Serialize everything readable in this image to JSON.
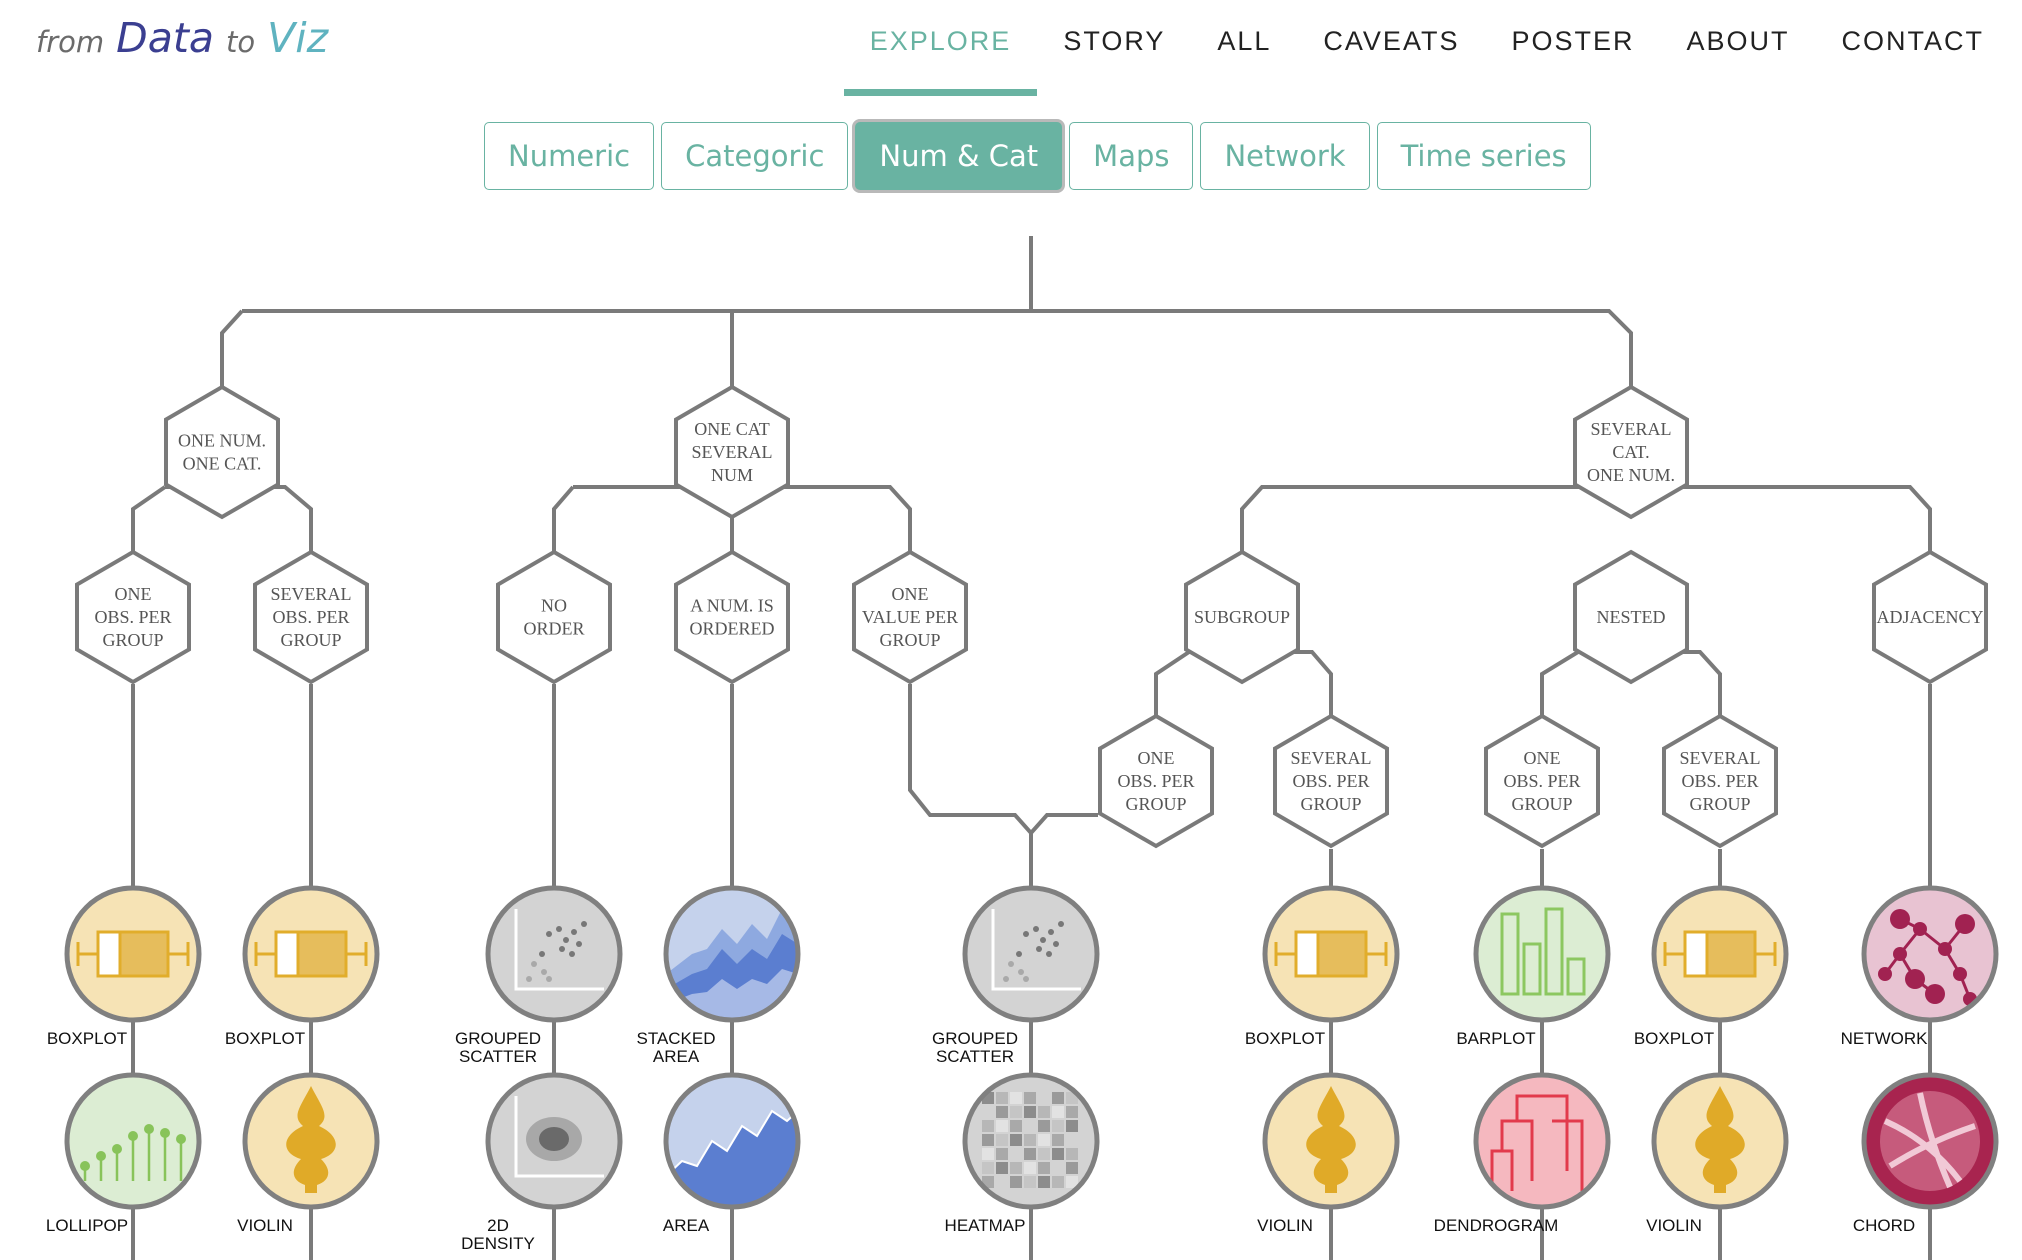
{
  "logo": {
    "from": "from",
    "data": "Data",
    "to": "to",
    "viz": "Viz"
  },
  "nav": [
    "EXPLORE",
    "STORY",
    "ALL",
    "CAVEATS",
    "POSTER",
    "ABOUT",
    "CONTACT"
  ],
  "tabs": [
    "Numeric",
    "Categoric",
    "Num & Cat",
    "Maps",
    "Network",
    "Time series"
  ],
  "active_tab": "Num & Cat",
  "colors": {
    "accent": "#69b3a2",
    "line": "#7a7a7a",
    "yellow": "#f6e3b5",
    "grey": "#d3d3d3",
    "blue": "#c5d2ec",
    "green": "#dcedd3",
    "pink": "#e8c3d2"
  },
  "hexagons": {
    "h1": [
      "ONE NUM.",
      "ONE CAT."
    ],
    "h2": [
      "ONE CAT",
      "SEVERAL",
      "NUM"
    ],
    "h3": [
      "SEVERAL",
      "CAT.",
      "ONE NUM."
    ],
    "h4": [
      "ONE",
      "OBS. PER",
      "GROUP"
    ],
    "h5": [
      "SEVERAL",
      "OBS. PER",
      "GROUP"
    ],
    "h6": [
      "NO",
      "ORDER"
    ],
    "h7": [
      "A NUM. IS",
      "ORDERED"
    ],
    "h8": [
      "ONE",
      "VALUE PER",
      "GROUP"
    ],
    "h9": [
      "SUBGROUP"
    ],
    "h10": [
      "NESTED"
    ],
    "h11": [
      "ADJACENCY"
    ],
    "h12": [
      "ONE",
      "OBS. PER",
      "GROUP"
    ],
    "h13": [
      "SEVERAL",
      "OBS. PER",
      "GROUP"
    ],
    "h14": [
      "ONE",
      "OBS. PER",
      "GROUP"
    ],
    "h15": [
      "SEVERAL",
      "OBS. PER",
      "GROUP"
    ]
  },
  "leaves": {
    "r1": [
      "BOXPLOT",
      "BOXPLOT",
      "GROUPED|SCATTER",
      "STACKED|AREA",
      "GROUPED|SCATTER",
      "BOXPLOT",
      "BARPLOT",
      "BOXPLOT",
      "NETWORK"
    ],
    "r2": [
      "LOLLIPOP",
      "VIOLIN",
      "2D|DENSITY",
      "AREA",
      "HEATMAP",
      "VIOLIN",
      "DENDROGRAM",
      "VIOLIN",
      "CHORD"
    ]
  }
}
